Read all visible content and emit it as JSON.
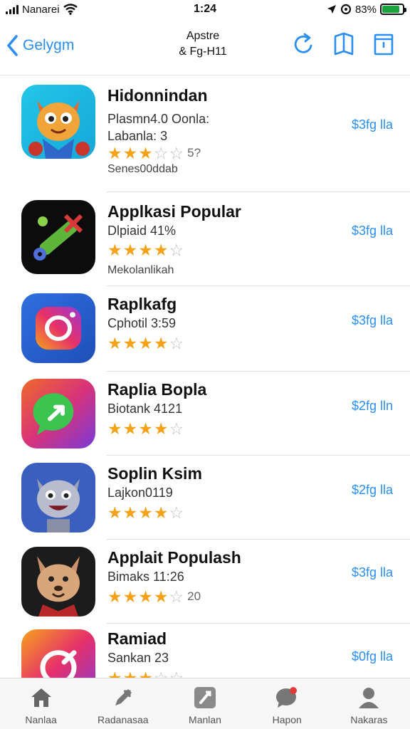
{
  "status_bar": {
    "carrier": "Nanarei",
    "time": "1:24",
    "battery": "83%"
  },
  "nav": {
    "back_label": "Gelygm",
    "title_line1": "Apstre",
    "title_line2": "& Fg-H11"
  },
  "apps": [
    {
      "name": "Hidonnindan",
      "line1": "Plasmn4.0 Oonla:",
      "line2": "Labanla: 3",
      "rating": 3,
      "rating_text": "5?",
      "extra": "Senes00ddab",
      "price": "$3fg lla"
    },
    {
      "name": "Applkasi Popular",
      "line1": "Dlpiaid 41%",
      "line2": "",
      "rating": 4,
      "rating_text": "",
      "extra": "Mekolanlikah",
      "price": "$3fg lla"
    },
    {
      "name": "Raplkafg",
      "line1": "Cphotil 3:59",
      "line2": "",
      "rating": 4,
      "rating_text": "",
      "extra": "",
      "price": "$3fg lla"
    },
    {
      "name": "Raplia Bopla",
      "line1": "Biotank 4121",
      "line2": "",
      "rating": 4,
      "rating_text": "",
      "extra": "",
      "price": "$2fg lln"
    },
    {
      "name": "Soplin Ksim",
      "line1": "Lajkon0119",
      "line2": "",
      "rating": 4,
      "rating_text": "",
      "extra": "",
      "price": "$2fg lla"
    },
    {
      "name": "Applait Populash",
      "line1": "Bimaks 11:26",
      "line2": "",
      "rating": 4,
      "rating_text": "20",
      "extra": "",
      "price": "$3fg lla"
    },
    {
      "name": "Ramiad",
      "line1": "Sankan 23",
      "line2": "",
      "rating": 3,
      "rating_text": "",
      "extra": "",
      "price": "$0fg lla"
    }
  ],
  "tabs": [
    {
      "label": "Nanlaa",
      "icon": "home-icon"
    },
    {
      "label": "Radanasaa",
      "icon": "pen-icon"
    },
    {
      "label": "Manlan",
      "icon": "tools-icon"
    },
    {
      "label": "Hapon",
      "icon": "chat-icon"
    },
    {
      "label": "Nakaras",
      "icon": "person-icon"
    }
  ],
  "colors": {
    "accent": "#2a8ff0",
    "star": "#f4a21a",
    "battery": "#1aa33a"
  }
}
